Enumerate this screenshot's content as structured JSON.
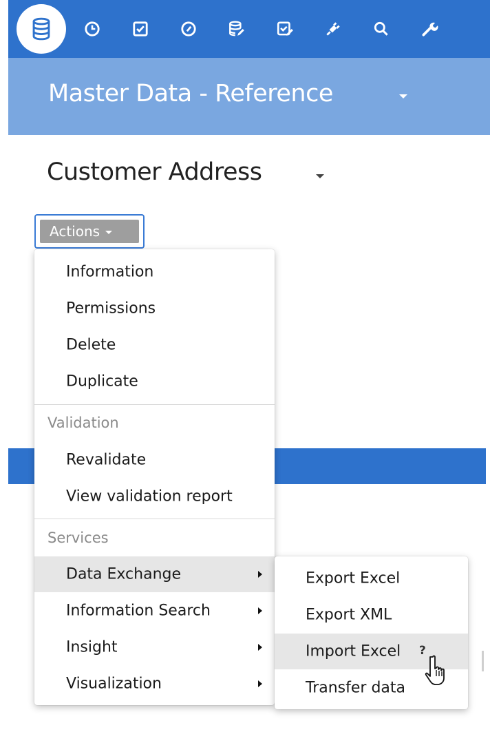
{
  "colors": {
    "topbar": "#2e72cc",
    "subbar": "#7aa7e0",
    "highlight": "#e6e6e6"
  },
  "topbar": {
    "icons": [
      "database-icon",
      "clock-icon",
      "checkbox-icon",
      "gauge-icon",
      "database-edit-icon",
      "checklist-icon",
      "plug-icon",
      "search-icon",
      "wrench-icon"
    ]
  },
  "header": {
    "title": "Master Data - Reference"
  },
  "page": {
    "title": "Customer Address"
  },
  "actions": {
    "label": "Actions"
  },
  "menu": {
    "items": [
      "Information",
      "Permissions",
      "Delete",
      "Duplicate"
    ],
    "validation_header": "Validation",
    "validation_items": [
      "Revalidate",
      "View validation report"
    ],
    "services_header": "Services",
    "services_items": [
      "Data Exchange",
      "Information Search",
      "Insight",
      "Visualization"
    ]
  },
  "submenu": {
    "items": [
      "Export Excel",
      "Export XML",
      "Import Excel",
      "Transfer data"
    ],
    "help": "?"
  }
}
